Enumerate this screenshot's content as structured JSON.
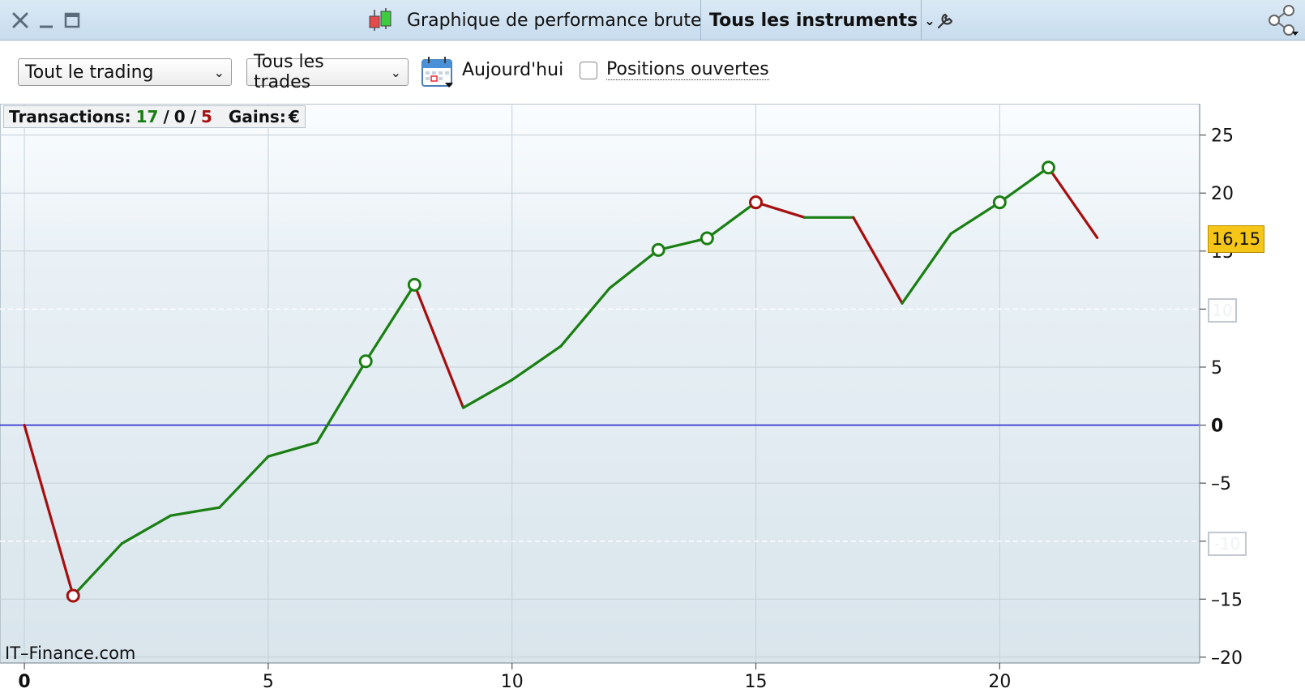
{
  "window": {
    "title": "Graphique de performance brute",
    "instrument_selector": "Tous les instruments"
  },
  "toolbar": {
    "trading_filter": "Tout le trading",
    "trades_filter": "Tous les trades",
    "date_label": "Aujourd'hui",
    "open_positions_label": "Positions ouvertes",
    "open_positions_checked": false
  },
  "stats": {
    "label": "Transactions:",
    "wins": "17",
    "sep1": "/",
    "neutral": "0",
    "sep2": "/",
    "losses": "5",
    "gains_label": "Gains:",
    "currency": "€"
  },
  "watermark": "IT–Finance.com",
  "current_value_badge": "16,15",
  "ghost_labels": {
    "upper": "10",
    "lower": "-10"
  },
  "colors": {
    "up": "#1a7f12",
    "down": "#a50f0f",
    "zero_line": "#1e1ecf",
    "badge": "#f5c518"
  },
  "chart_data": {
    "type": "line",
    "x": [
      0,
      1,
      2,
      3,
      4,
      5,
      6,
      7,
      8,
      9,
      10,
      11,
      12,
      13,
      14,
      15,
      16,
      17,
      18,
      19,
      20,
      21,
      22
    ],
    "y": [
      0,
      -14.7,
      -10.2,
      -7.8,
      -7.1,
      -2.7,
      -1.5,
      5.5,
      12.1,
      1.5,
      3.9,
      6.8,
      11.8,
      15.1,
      16.1,
      19.2,
      17.9,
      17.9,
      10.5,
      16.5,
      19.2,
      22.2,
      16.15
    ],
    "markers": [
      {
        "x": 1,
        "color": "down"
      },
      {
        "x": 7,
        "color": "up"
      },
      {
        "x": 8,
        "color": "up"
      },
      {
        "x": 13,
        "color": "up"
      },
      {
        "x": 14,
        "color": "up"
      },
      {
        "x": 15,
        "color": "down"
      },
      {
        "x": 20,
        "color": "up"
      },
      {
        "x": 21,
        "color": "up"
      }
    ],
    "x_ticks": [
      "0",
      "5",
      "10",
      "15",
      "20"
    ],
    "x_tick_values": [
      0,
      5,
      10,
      15,
      20
    ],
    "y_tick_labels": [
      "25",
      "20",
      "15",
      "10",
      "5",
      "0",
      "–5",
      "–10",
      "–15",
      "–20"
    ],
    "y_tick_values": [
      25,
      20,
      15,
      10,
      5,
      0,
      -5,
      -10,
      -15,
      -20
    ],
    "xlim": [
      -0.5,
      24.1
    ],
    "ylim": [
      -20.5,
      27.7
    ],
    "dashed_levels": [
      10,
      -10
    ],
    "grid": true
  }
}
